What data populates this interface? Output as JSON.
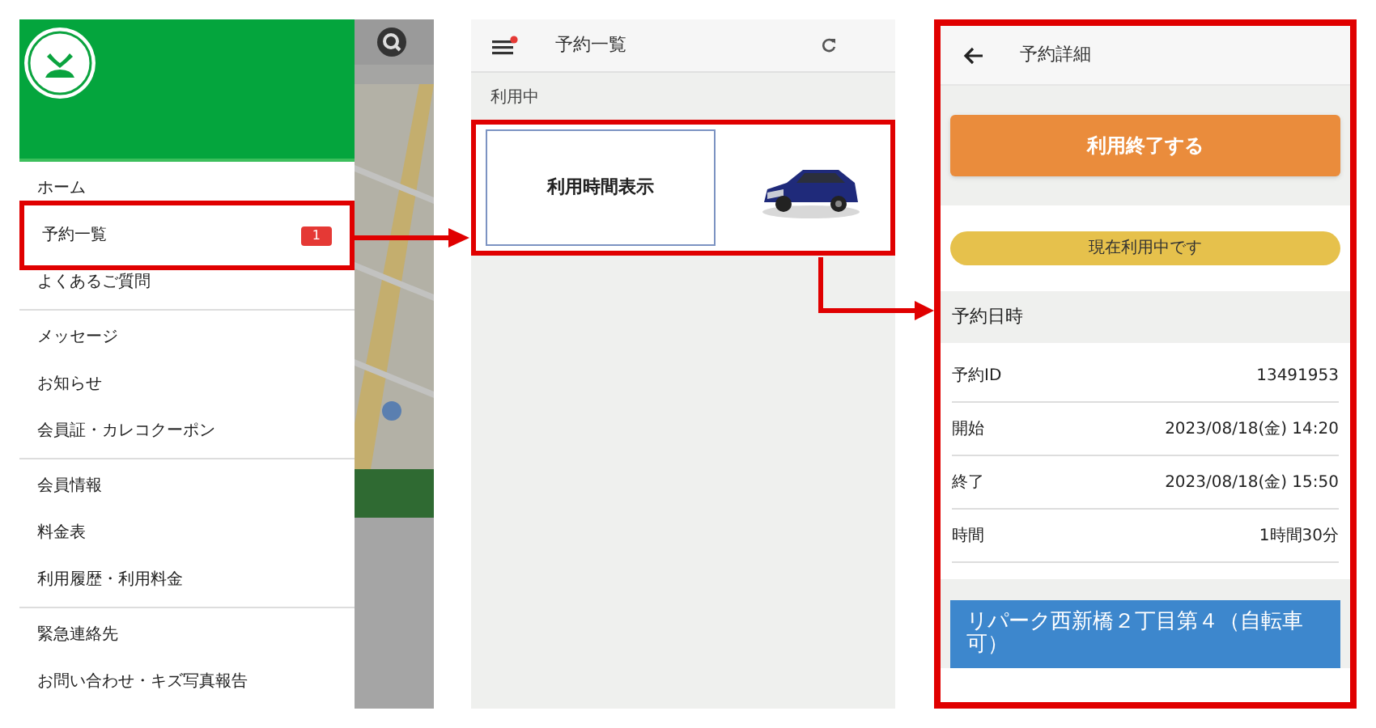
{
  "drawer": {
    "sections": [
      [
        {
          "label": "ホーム",
          "highlighted": false
        },
        {
          "label": "予約一覧",
          "highlighted": true,
          "badge": "1"
        },
        {
          "label": "よくあるご質問",
          "highlighted": false
        }
      ],
      [
        {
          "label": "メッセージ",
          "highlighted": false
        },
        {
          "label": "お知らせ",
          "highlighted": false
        },
        {
          "label": "会員証・カレコクーポン",
          "highlighted": false
        }
      ],
      [
        {
          "label": "会員情報",
          "highlighted": false
        },
        {
          "label": "料金表",
          "highlighted": false
        },
        {
          "label": "利用履歴・利用料金",
          "highlighted": false
        }
      ],
      [
        {
          "label": "緊急連絡先",
          "highlighted": false
        },
        {
          "label": "お問い合わせ・キズ写真報告",
          "highlighted": false
        }
      ]
    ]
  },
  "reservations": {
    "title": "予約一覧",
    "notification_dot": true,
    "section_label": "利用中",
    "card": {
      "label": "利用時間表示",
      "highlighted": true
    }
  },
  "detail": {
    "title": "予約詳細",
    "highlighted": true,
    "end_button": "利用終了する",
    "status": "現在利用中です",
    "section_title": "予約日時",
    "rows": [
      {
        "label": "予約ID",
        "value": "13491953"
      },
      {
        "label": "開始",
        "value": "2023/08/18(金) 14:20"
      },
      {
        "label": "終了",
        "value": "2023/08/18(金) 15:50"
      },
      {
        "label": "時間",
        "value": "1時間30分"
      }
    ],
    "location": "リパーク西新橋２丁目第４（自転車可）"
  }
}
